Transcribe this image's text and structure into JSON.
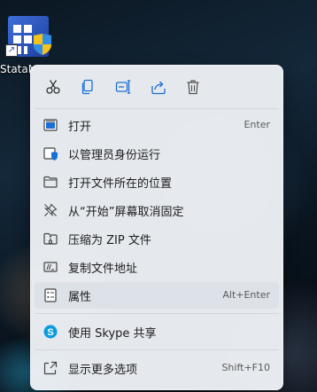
{
  "desktop": {
    "icon_label": "StataM"
  },
  "toolbar": {
    "buttons": [
      {
        "name": "cut",
        "icon": "scissors-icon"
      },
      {
        "name": "copy",
        "icon": "copy-icon"
      },
      {
        "name": "rename",
        "icon": "rename-icon"
      },
      {
        "name": "share",
        "icon": "share-icon"
      },
      {
        "name": "delete",
        "icon": "trash-icon"
      }
    ]
  },
  "menu": {
    "items": [
      {
        "label": "打开",
        "shortcut": "Enter",
        "icon": "open-app-icon"
      },
      {
        "label": "以管理员身份运行",
        "shortcut": "",
        "icon": "admin-shield-icon"
      },
      {
        "label": "打开文件所在的位置",
        "shortcut": "",
        "icon": "folder-icon"
      },
      {
        "label": "从“开始”屏幕取消固定",
        "shortcut": "",
        "icon": "unpin-icon"
      },
      {
        "label": "压缩为 ZIP 文件",
        "shortcut": "",
        "icon": "zip-folder-icon"
      },
      {
        "label": "复制文件地址",
        "shortcut": "",
        "icon": "copy-path-icon"
      },
      {
        "label": "属性",
        "shortcut": "Alt+Enter",
        "icon": "properties-icon"
      },
      {
        "label": "使用 Skype 共享",
        "shortcut": "",
        "icon": "skype-icon"
      },
      {
        "label": "显示更多选项",
        "shortcut": "Shift+F10",
        "icon": "more-options-icon"
      }
    ]
  },
  "colors": {
    "accent": "#1a6fd4",
    "skype": "#0a9cde",
    "menu_bg": "#eef1f6"
  }
}
